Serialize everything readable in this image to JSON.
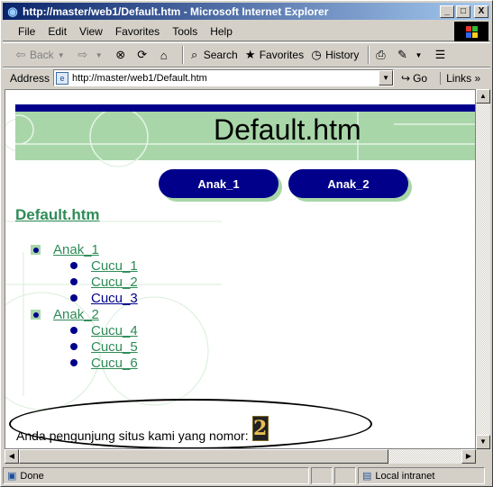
{
  "window": {
    "title": "http://master/web1/Default.htm - Microsoft Internet Explorer",
    "minimize": "_",
    "maximize": "□",
    "close": "X"
  },
  "menu": [
    "File",
    "Edit",
    "View",
    "Favorites",
    "Tools",
    "Help"
  ],
  "toolbar": {
    "back": "Back",
    "search": "Search",
    "favorites": "Favorites",
    "history": "History"
  },
  "address": {
    "label": "Address",
    "url": "http://master/web1/Default.htm",
    "go": "Go",
    "links": "Links"
  },
  "page": {
    "banner_title": "Default.htm",
    "nav_buttons": [
      "Anak_1",
      "Anak_2"
    ],
    "page_title": "Default.htm",
    "tree": [
      {
        "label": "Anak_1",
        "children": [
          "Cucu_1",
          "Cucu_2",
          "Cucu_3"
        ]
      },
      {
        "label": "Anak_2",
        "children": [
          "Cucu_4",
          "Cucu_5",
          "Cucu_6"
        ]
      }
    ],
    "counter_text": "Anda pengunjung situs kami yang nomor:",
    "counter_value": "2"
  },
  "status": {
    "text": "Done",
    "zone": "Local intranet"
  },
  "colors": {
    "accent_green": "#a8d6a8",
    "navy": "#00008b",
    "link_green": "#2e8b57"
  }
}
